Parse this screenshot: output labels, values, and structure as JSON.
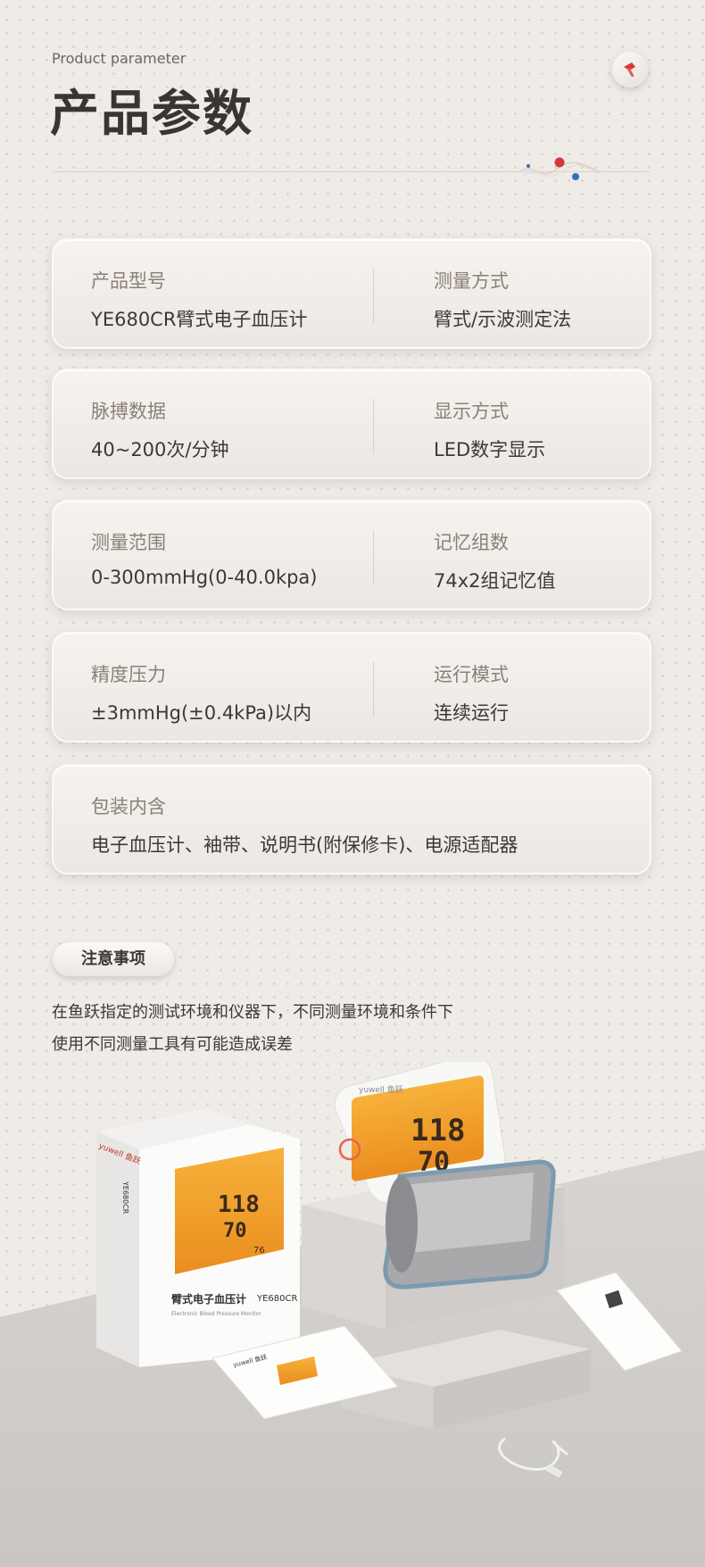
{
  "header": {
    "subtitle": "Product parameter",
    "title": "产品参数"
  },
  "params": [
    {
      "left_label": "产品型号",
      "left_value": "YE680CR臂式电子血压计",
      "right_label": "测量方式",
      "right_value": "臂式/示波测定法"
    },
    {
      "left_label": "脉搏数据",
      "left_value": "40~200次/分钟",
      "right_label": "显示方式",
      "right_value": "LED数字显示"
    },
    {
      "left_label": "测量范围",
      "left_value": "0-300mmHg(0-40.0kpa)",
      "right_label": "记忆组数",
      "right_value": "74x2组记忆值"
    },
    {
      "left_label": "精度压力",
      "left_value": "±3mmHg(±0.4kPa)以内",
      "right_label": "运行模式",
      "right_value": "连续运行"
    }
  ],
  "package": {
    "label": "包装内含",
    "value": "电子血压计、袖带、说明书(附保修卡)、电源适配器"
  },
  "notice": {
    "title": "注意事项",
    "line1": "在鱼跃指定的测试环境和仪器下，不同测量环境和条件下",
    "line2": "使用不同测量工具有可能造成误差"
  },
  "product": {
    "brand": "yuwell 鱼跃",
    "box_name": "臂式电子血压计",
    "box_name_en": "Electronic Blood Pressure Monitor",
    "model": "YE680CR",
    "box_spine": "YE680CR",
    "screen_sys": "118",
    "screen_dia": "70",
    "screen_pulse": "76"
  },
  "colors": {
    "accent_red": "#d8373a",
    "accent_blue": "#2f6fc0",
    "screen_orange": "#f3a32c",
    "text_dark": "#3d3835"
  }
}
